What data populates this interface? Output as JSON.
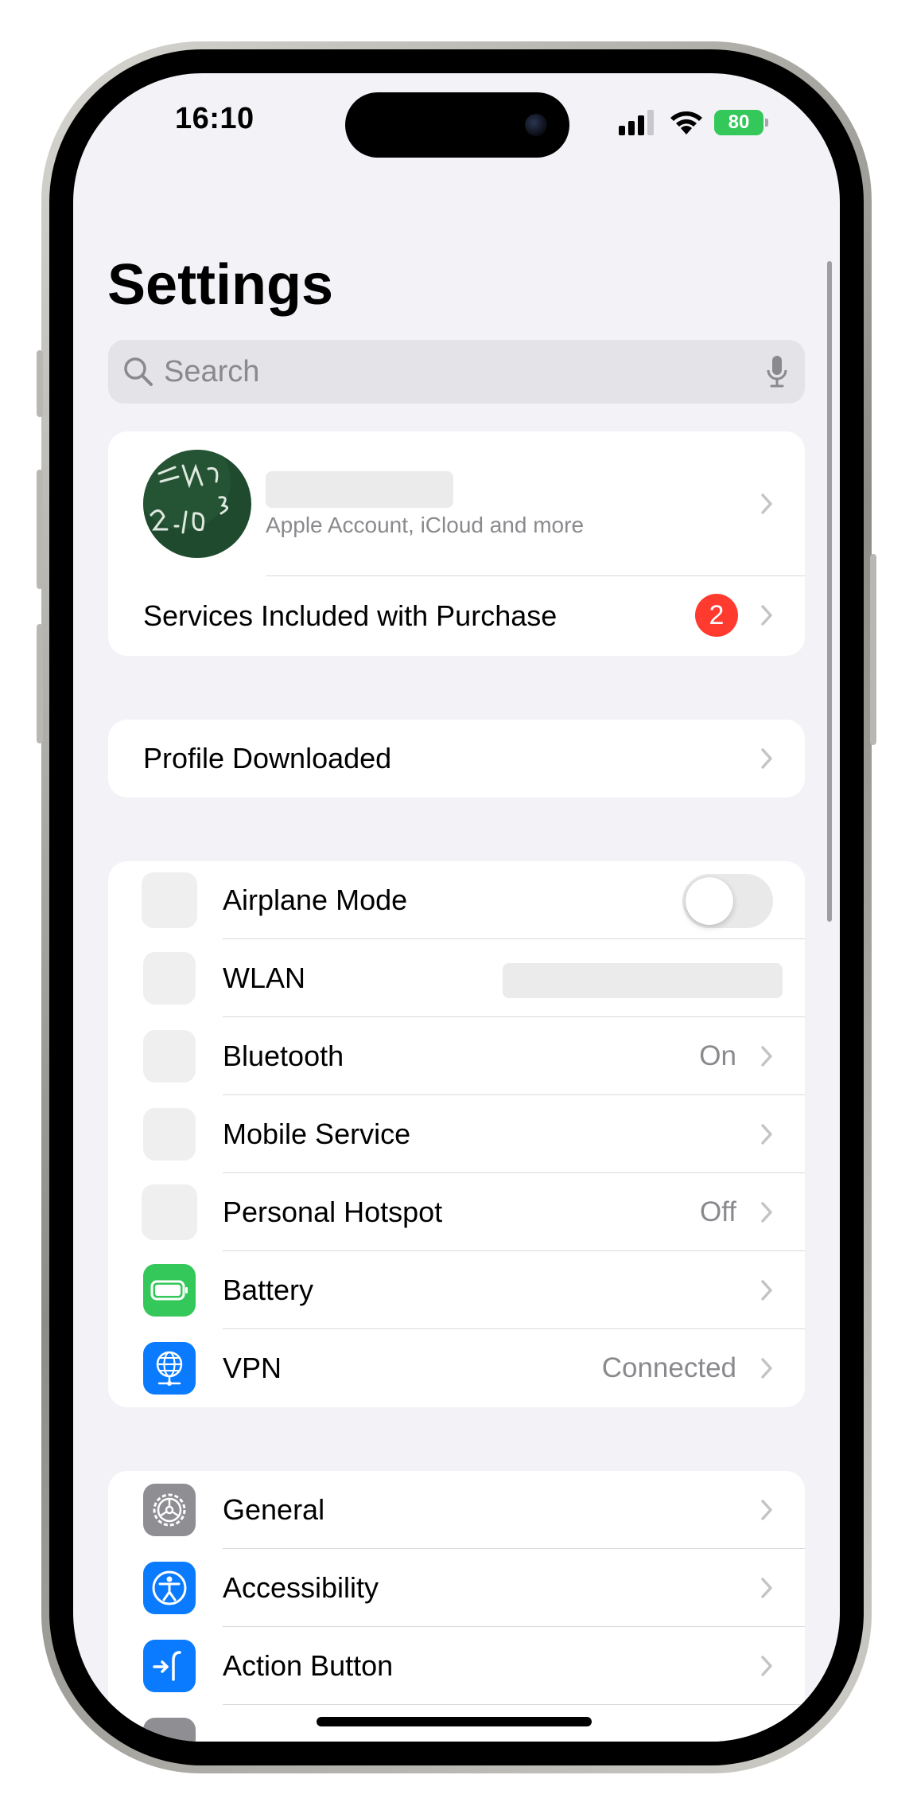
{
  "status_bar": {
    "time": "16:10",
    "battery": "80"
  },
  "page": {
    "title": "Settings"
  },
  "search": {
    "placeholder": "Search"
  },
  "account": {
    "subtitle": "Apple Account, iCloud and more"
  },
  "services": {
    "label": "Services Included with Purchase",
    "badge": "2"
  },
  "profile": {
    "label": "Profile Downloaded"
  },
  "connectivity": {
    "airplane": {
      "label": "Airplane Mode",
      "on": false
    },
    "wlan": {
      "label": "WLAN"
    },
    "bluetooth": {
      "label": "Bluetooth",
      "value": "On"
    },
    "mobile": {
      "label": "Mobile Service"
    },
    "hotspot": {
      "label": "Personal Hotspot",
      "value": "Off"
    },
    "battery": {
      "label": "Battery",
      "icon": "battery-icon",
      "color": "#34c759"
    },
    "vpn": {
      "label": "VPN",
      "value": "Connected",
      "icon": "vpn-globe-icon",
      "color": "#0a7aff"
    }
  },
  "general_group": {
    "general": {
      "label": "General",
      "icon": "gear-icon",
      "color": "#8e8e93"
    },
    "accessibility": {
      "label": "Accessibility",
      "icon": "accessibility-icon",
      "color": "#0a7aff"
    },
    "action_button": {
      "label": "Action Button",
      "icon": "action-button-icon",
      "color": "#0a7aff"
    }
  }
}
